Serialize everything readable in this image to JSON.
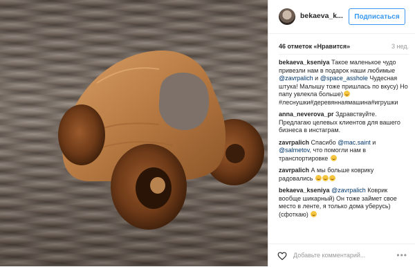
{
  "post": {
    "username": "bekaeva_k...",
    "follow_label": "Подписаться",
    "likes": "46 отметок «Нравится»",
    "age": "3 нед.",
    "add_comment": "Добавьте комментарий...",
    "more": "•••"
  },
  "comments": [
    {
      "user": "bekaeva_kseniya",
      "parts": [
        {
          "t": "text",
          "v": " Такое маленькое чудо привезли нам в подарок наши любимые "
        },
        {
          "t": "mention",
          "v": "@zavrpalich"
        },
        {
          "t": "text",
          "v": " и "
        },
        {
          "t": "mention",
          "v": "@space_asshole"
        },
        {
          "t": "text",
          "v": " Чудесная штука! Малышу тоже пришлась по вкусу) Но папу увлекла больше)"
        },
        {
          "t": "emoji",
          "v": "smile"
        },
        {
          "t": "text",
          "v": " #леснушки#деревяннаямашина#игрушки"
        }
      ]
    },
    {
      "user": "anna_neverova_pr",
      "parts": [
        {
          "t": "text",
          "v": " Здравствуйте. Предлагаю целевых клиентов для вашего бизнеса в инстаграм."
        }
      ]
    },
    {
      "user": "zavrpalich",
      "parts": [
        {
          "t": "text",
          "v": " Спасибо "
        },
        {
          "t": "mention",
          "v": "@mac.saint"
        },
        {
          "t": "text",
          "v": " и "
        },
        {
          "t": "mention",
          "v": "@salmetov"
        },
        {
          "t": "text",
          "v": ", что помогли нам в транспортировке "
        },
        {
          "t": "emoji",
          "v": "smile"
        }
      ]
    },
    {
      "user": "zavrpalich",
      "parts": [
        {
          "t": "text",
          "v": " А мы больше коврику радовались "
        },
        {
          "t": "emoji",
          "v": "smile"
        },
        {
          "t": "emoji",
          "v": "smile"
        },
        {
          "t": "emoji",
          "v": "smile"
        }
      ]
    },
    {
      "user": "bekaeva_kseniya",
      "parts": [
        {
          "t": "text",
          "v": " "
        },
        {
          "t": "mention",
          "v": "@zavrpalich"
        },
        {
          "t": "text",
          "v": " Коврик вообще шикарный) Он тоже займет свое место в ленте, я только дома уберусь) (сфоткаю) "
        },
        {
          "t": "emoji",
          "v": "smile"
        }
      ]
    }
  ]
}
